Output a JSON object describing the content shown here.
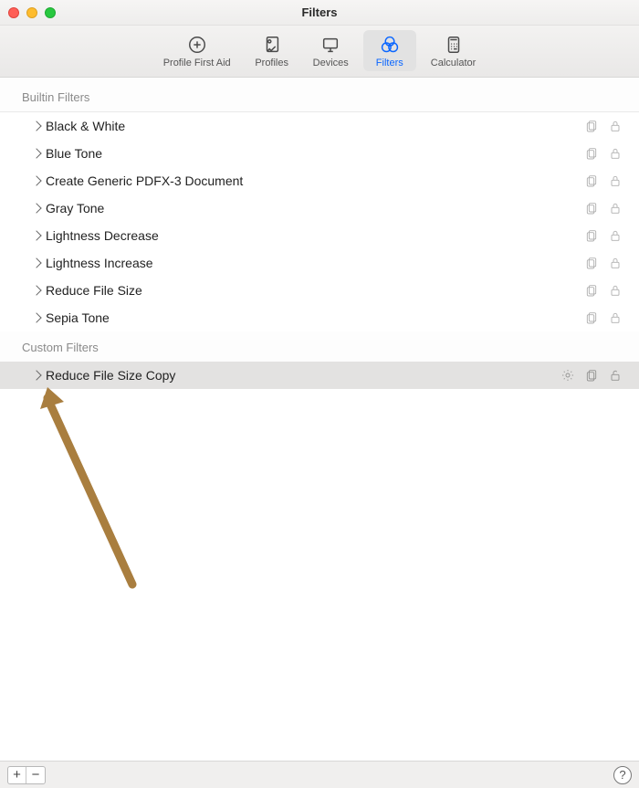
{
  "window": {
    "title": "Filters"
  },
  "tabs": [
    {
      "label": "Profile First Aid"
    },
    {
      "label": "Profiles"
    },
    {
      "label": "Devices"
    },
    {
      "label": "Filters"
    },
    {
      "label": "Calculator"
    }
  ],
  "sections": {
    "builtin": {
      "header": "Builtin Filters",
      "items": [
        {
          "label": "Black & White"
        },
        {
          "label": "Blue Tone"
        },
        {
          "label": "Create Generic PDFX-3 Document"
        },
        {
          "label": "Gray Tone"
        },
        {
          "label": "Lightness Decrease"
        },
        {
          "label": "Lightness Increase"
        },
        {
          "label": "Reduce File Size"
        },
        {
          "label": "Sepia Tone"
        }
      ]
    },
    "custom": {
      "header": "Custom Filters",
      "items": [
        {
          "label": "Reduce File Size Copy"
        }
      ]
    }
  },
  "buttons": {
    "plus": "+",
    "minus": "−",
    "help": "?"
  }
}
